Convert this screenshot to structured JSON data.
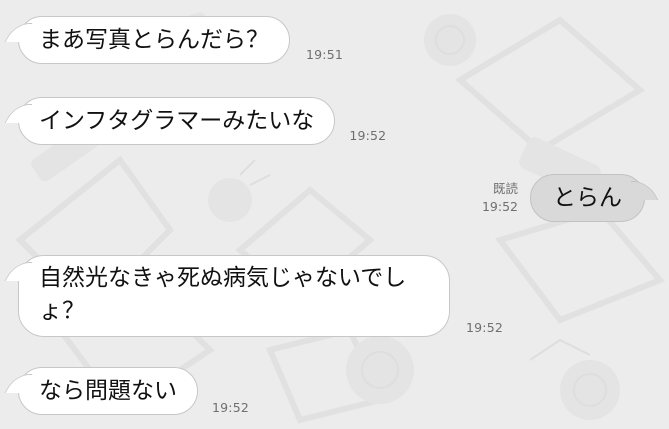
{
  "messages": [
    {
      "direction": "incoming",
      "text": "まあ写真とらんだら？",
      "time": "19:51"
    },
    {
      "direction": "incoming",
      "text": "インフタグラマーみたいな",
      "time": "19:52"
    },
    {
      "direction": "outgoing",
      "text": "とらん",
      "time": "19:52",
      "read_label": "既読"
    },
    {
      "direction": "incoming",
      "text_line1": "自然光なきゃ死ぬ病気じゃないでし",
      "text_line2": "ょ？",
      "time": "19:52"
    },
    {
      "direction": "incoming",
      "text": "なら問題ない",
      "time": "19:52"
    }
  ],
  "colors": {
    "background": "#ececec",
    "incoming_bubble": "#ffffff",
    "outgoing_bubble": "#d9d9d9",
    "bubble_border": "#c7c7c7",
    "timestamp": "#6f6f6f"
  }
}
